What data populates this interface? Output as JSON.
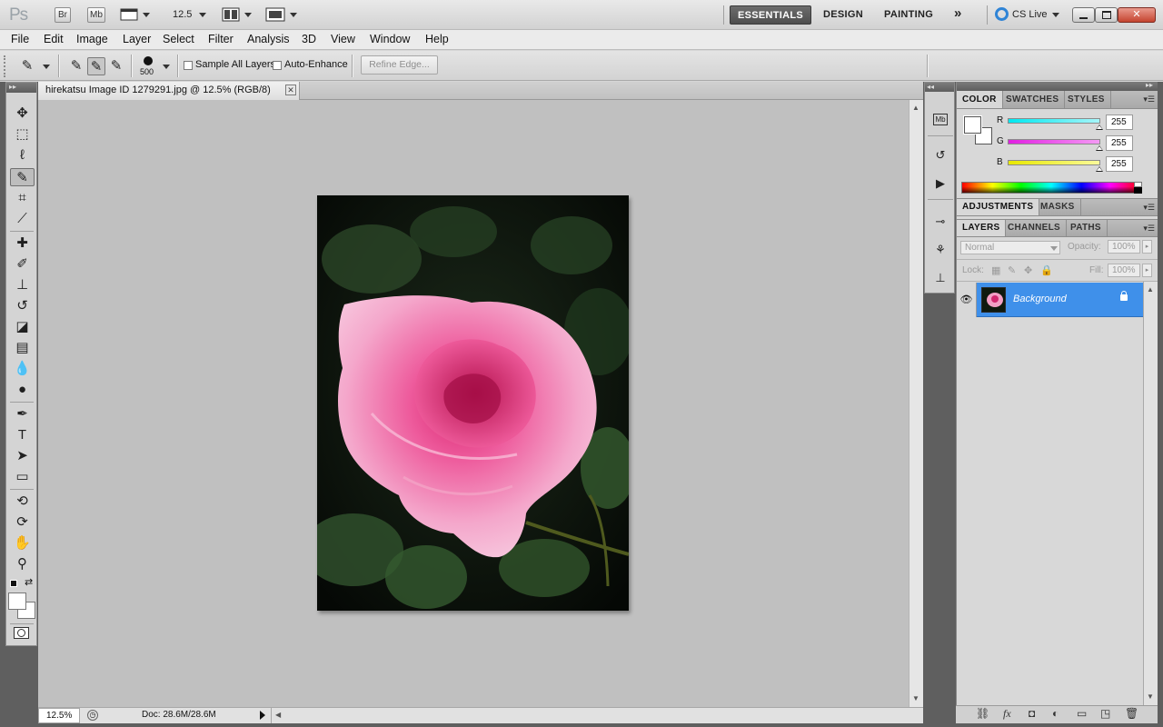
{
  "app": {
    "logo": "Ps",
    "bridge_label": "Br",
    "minibridge_label": "Mb",
    "zoom_value": "12.5",
    "workspaces": [
      "ESSENTIALS",
      "DESIGN",
      "PAINTING"
    ],
    "more_workspaces": "»",
    "cs_live": "CS Live"
  },
  "menu": [
    "File",
    "Edit",
    "Image",
    "Layer",
    "Select",
    "Filter",
    "Analysis",
    "3D",
    "View",
    "Window",
    "Help"
  ],
  "options": {
    "brush_size": "500",
    "sample_all_layers": "Sample All Layers",
    "auto_enhance": "Auto-Enhance",
    "refine_edge": "Refine Edge..."
  },
  "document": {
    "tab_title": "hirekatsu Image ID 1279291.jpg @ 12.5% (RGB/8)",
    "zoom": "12.5%",
    "doc_info": "Doc: 28.6M/28.6M"
  },
  "color_panel": {
    "tabs": [
      "COLOR",
      "SWATCHES",
      "STYLES"
    ],
    "channels": [
      {
        "label": "R",
        "value": "255",
        "color": "#00d8e6"
      },
      {
        "label": "G",
        "value": "255",
        "color": "#e61ce6"
      },
      {
        "label": "B",
        "value": "255",
        "color": "#e6e600"
      }
    ]
  },
  "adjustments_panel": {
    "tabs": [
      "ADJUSTMENTS",
      "MASKS"
    ]
  },
  "layers_panel": {
    "tabs": [
      "LAYERS",
      "CHANNELS",
      "PATHS"
    ],
    "blend_mode": "Normal",
    "opacity_label": "Opacity:",
    "opacity_value": "100%",
    "lock_label": "Lock:",
    "fill_label": "Fill:",
    "fill_value": "100%",
    "layers": [
      {
        "name": "Background",
        "locked": true,
        "visible": true
      }
    ]
  },
  "colors": {
    "accent_selected_layer": "#3f90ea",
    "workspace_active": "#555555"
  }
}
